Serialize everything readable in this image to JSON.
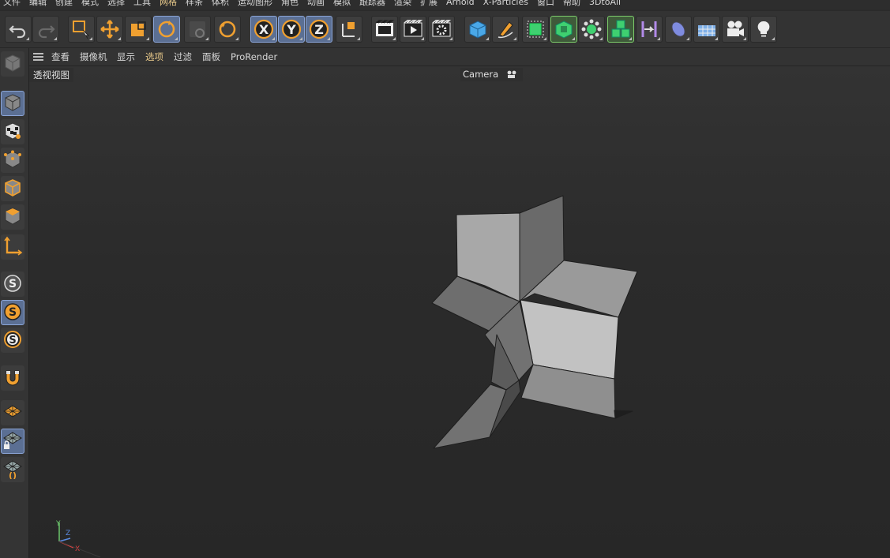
{
  "menu": [
    {
      "label": "文件",
      "hl": false
    },
    {
      "label": "编辑",
      "hl": false
    },
    {
      "label": "创建",
      "hl": false
    },
    {
      "label": "模式",
      "hl": false
    },
    {
      "label": "选择",
      "hl": false
    },
    {
      "label": "工具",
      "hl": false
    },
    {
      "label": "网格",
      "hl": true
    },
    {
      "label": "样条",
      "hl": false
    },
    {
      "label": "体积",
      "hl": false
    },
    {
      "label": "运动图形",
      "hl": false
    },
    {
      "label": "角色",
      "hl": false
    },
    {
      "label": "动画",
      "hl": false
    },
    {
      "label": "模拟",
      "hl": false
    },
    {
      "label": "跟踪器",
      "hl": false
    },
    {
      "label": "渲染",
      "hl": false
    },
    {
      "label": "扩展",
      "hl": false
    },
    {
      "label": "Arnold",
      "hl": false
    },
    {
      "label": "X-Particles",
      "hl": false
    },
    {
      "label": "窗口",
      "hl": false
    },
    {
      "label": "帮助",
      "hl": false
    },
    {
      "label": "3DtoAll",
      "hl": false
    }
  ],
  "toolbar": [
    {
      "icon": "undo-icon",
      "active": false
    },
    {
      "icon": "redo-icon",
      "active": false
    },
    {
      "icon": "live-selection-icon",
      "active": false
    },
    {
      "icon": "move-icon",
      "active": false
    },
    {
      "icon": "scale-icon",
      "active": false
    },
    {
      "icon": "rotate-icon",
      "active": true
    },
    {
      "icon": "recent-tools-icon",
      "active": false
    },
    {
      "icon": "rotate-orange-icon",
      "active": false
    },
    {
      "icon": "x-axis-icon",
      "active": true,
      "letter": "X"
    },
    {
      "icon": "y-axis-icon",
      "active": true,
      "letter": "Y"
    },
    {
      "icon": "z-axis-icon",
      "active": true,
      "letter": "Z"
    },
    {
      "icon": "coordinate-system-icon",
      "active": false
    },
    {
      "icon": "render-view-icon",
      "active": false
    },
    {
      "icon": "render-picture-viewer-icon",
      "active": false
    },
    {
      "icon": "render-settings-icon",
      "active": false
    },
    {
      "icon": "cube-icon",
      "active": false
    },
    {
      "icon": "pen-icon",
      "active": false
    },
    {
      "icon": "subdivision-icon",
      "active": false
    },
    {
      "icon": "extrude-icon",
      "active": false
    },
    {
      "icon": "cloner-icon",
      "active": false
    },
    {
      "icon": "mograph-cubes-icon",
      "active": false
    },
    {
      "icon": "bend-deformer-icon",
      "active": false
    },
    {
      "icon": "field-icon",
      "active": false
    },
    {
      "icon": "floor-icon",
      "active": false
    },
    {
      "icon": "camera-icon",
      "active": false
    },
    {
      "icon": "light-icon",
      "active": false
    }
  ],
  "leftpanel": [
    {
      "icon": "make-editable-icon"
    },
    {
      "icon": "model-mode-icon"
    },
    {
      "icon": "texture-mode-icon"
    },
    {
      "icon": "points-mode-icon"
    },
    {
      "icon": "edges-mode-icon"
    },
    {
      "icon": "polygons-mode-icon"
    },
    {
      "icon": "axis-mode-icon"
    },
    {
      "icon": "snap-icon"
    },
    {
      "icon": "snap-enable-icon"
    },
    {
      "icon": "snap-settings-icon"
    },
    {
      "icon": "magnet-icon"
    },
    {
      "icon": "workplane-icon"
    },
    {
      "icon": "locked-workplane-icon"
    },
    {
      "icon": "workplane-settings-icon"
    }
  ],
  "viewmenu": [
    {
      "label": "查看",
      "hl": false
    },
    {
      "label": "摄像机",
      "hl": false
    },
    {
      "label": "显示",
      "hl": false
    },
    {
      "label": "选项",
      "hl": true
    },
    {
      "label": "过滤",
      "hl": false
    },
    {
      "label": "面板",
      "hl": false
    },
    {
      "label": "ProRender",
      "hl": false
    }
  ],
  "viewport": {
    "view_name": "透视视图",
    "camera_label": "Camera",
    "axis_y": "Y",
    "axis_z": "Z",
    "axis_x": "X"
  },
  "colors": {
    "accent_orange": "#f0a030",
    "active_blue": "#5b6f93",
    "menu_highlight": "#e8c98a",
    "axis_x": "#e04040",
    "axis_y": "#6cc66c",
    "axis_z": "#5a8ae0"
  }
}
